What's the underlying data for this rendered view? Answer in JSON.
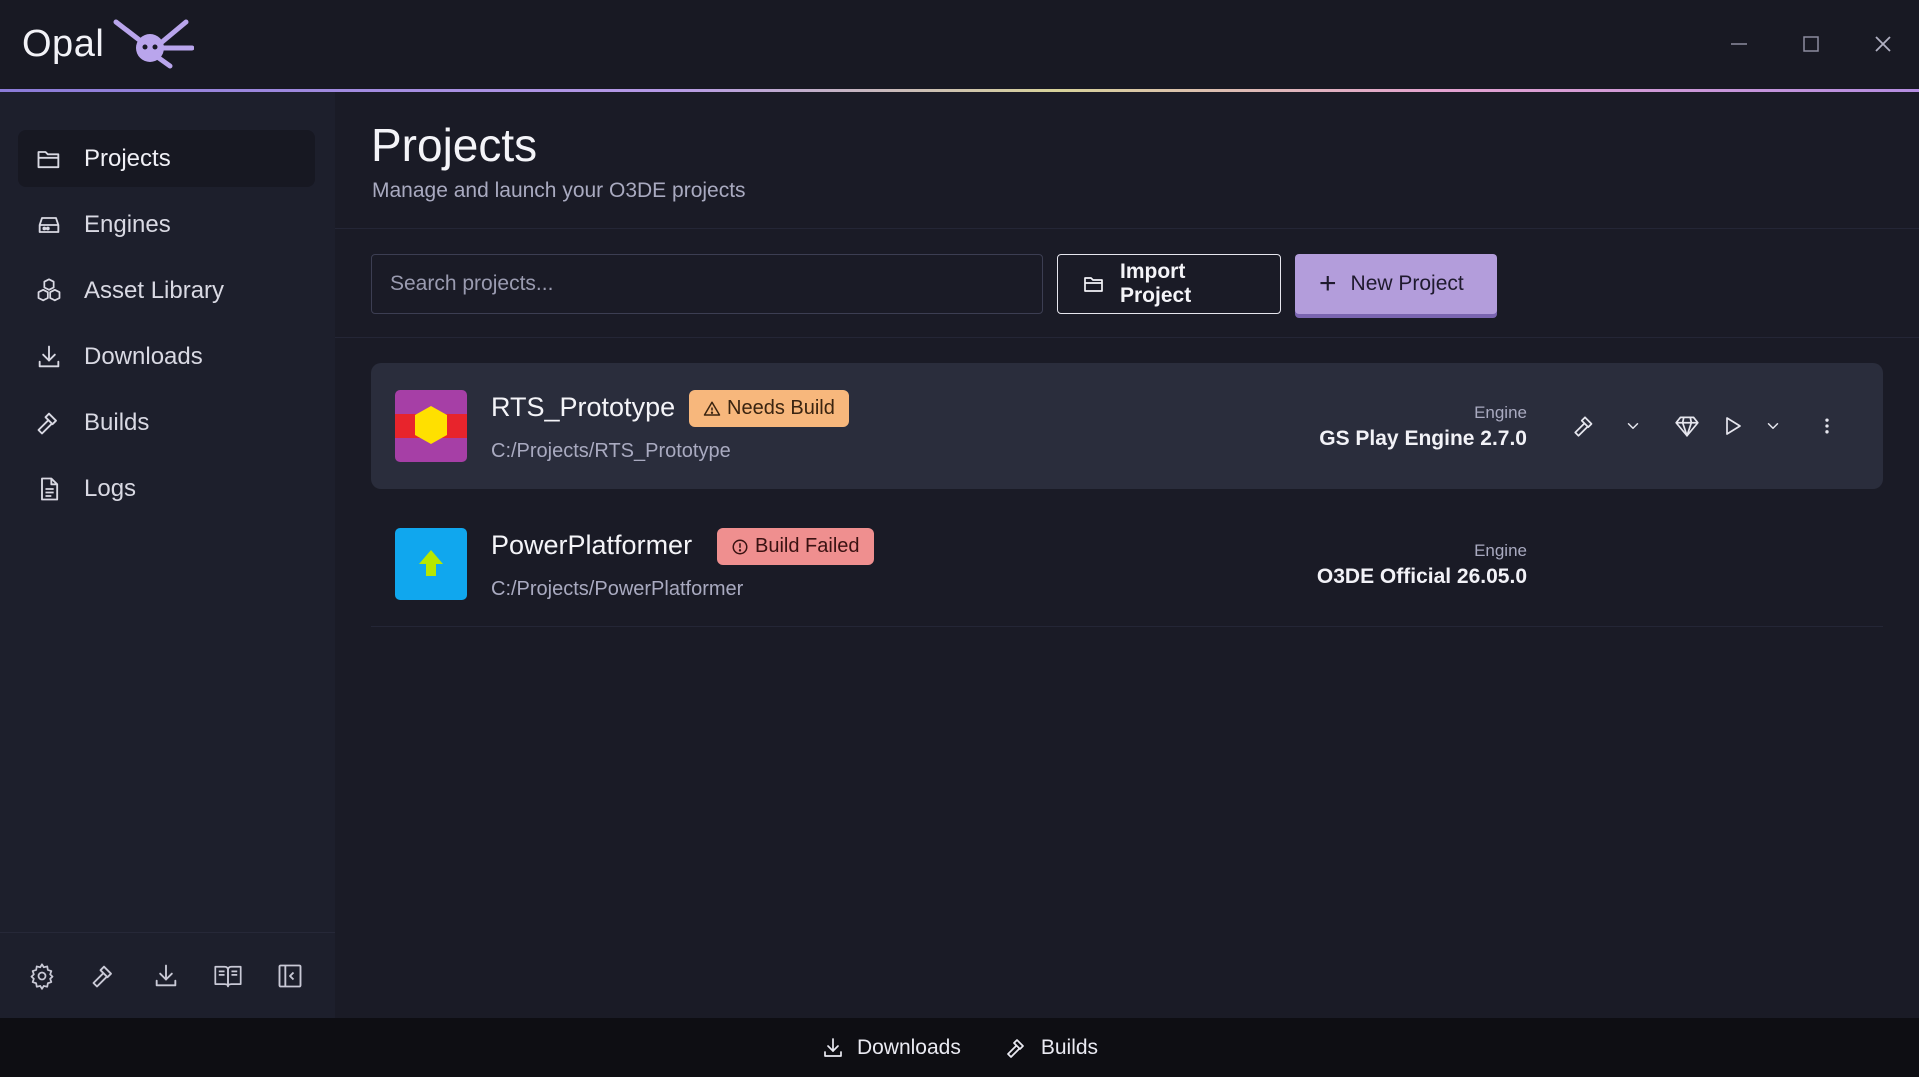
{
  "app": {
    "name": "Opal"
  },
  "window": {
    "minimize_icon": "minimize-icon",
    "maximize_icon": "maximize-icon",
    "close_icon": "close-icon"
  },
  "sidebar": {
    "items": [
      {
        "label": "Projects",
        "icon": "folder-icon",
        "active": true
      },
      {
        "label": "Engines",
        "icon": "drive-icon",
        "active": false
      },
      {
        "label": "Asset Library",
        "icon": "cubes-icon",
        "active": false
      },
      {
        "label": "Downloads",
        "icon": "download-icon",
        "active": false
      },
      {
        "label": "Builds",
        "icon": "hammer-icon",
        "active": false
      },
      {
        "label": "Logs",
        "icon": "document-icon",
        "active": false
      }
    ],
    "footer_icons": [
      "settings-icon",
      "hammer-icon",
      "download-icon",
      "book-icon",
      "collapse-sidebar-icon"
    ]
  },
  "main": {
    "title": "Projects",
    "subtitle": "Manage and launch your O3DE projects",
    "search": {
      "placeholder": "Search projects...",
      "value": ""
    },
    "import_label": "Import Project",
    "new_label": "New Project"
  },
  "projects": [
    {
      "name": "RTS_Prototype",
      "badge": "Needs Build",
      "badge_type": "warning",
      "path": "C:/Projects/RTS_Prototype",
      "engine_label": "Engine",
      "engine": "GS Play Engine 2.7.0"
    },
    {
      "name": "PowerPlatformer",
      "badge": "Build Failed",
      "badge_type": "error",
      "path": "C:/Projects/PowerPlatformer",
      "engine_label": "Engine",
      "engine": "O3DE Official 26.05.0"
    }
  ],
  "statusbar": {
    "downloads": "Downloads",
    "builds": "Builds"
  },
  "colors": {
    "accent": "#b39ddb",
    "warning_badge": "#f7b77c",
    "error_badge": "#ef8f8f",
    "background": "#1a1b26",
    "sidebar": "#1d1f2c"
  }
}
